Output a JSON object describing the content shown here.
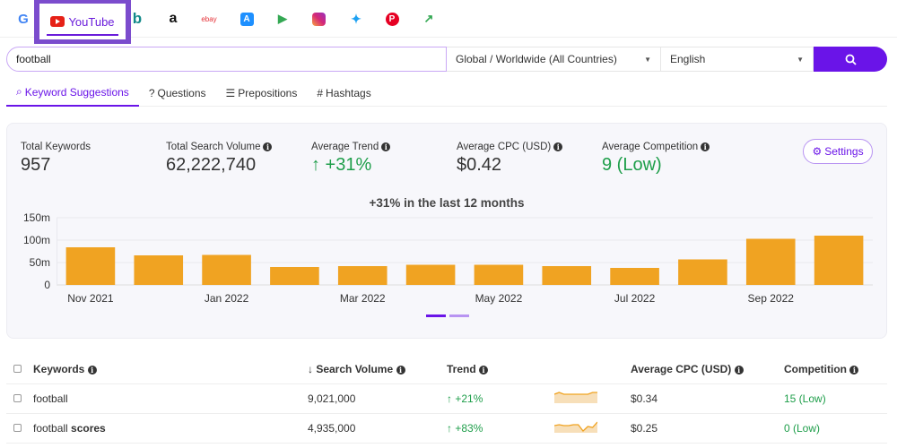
{
  "engines": [
    {
      "name": "google",
      "glyph": "G",
      "color": "#4285f4"
    },
    {
      "name": "youtube",
      "label": "YouTube",
      "active": true
    },
    {
      "name": "bing",
      "glyph": "b",
      "color": "#138a8a"
    },
    {
      "name": "amazon",
      "glyph": "a",
      "color": "#111"
    },
    {
      "name": "ebay",
      "glyph": "ebay",
      "color": "#e53238"
    },
    {
      "name": "app-store",
      "glyph": "A",
      "color": "#1e90ff"
    },
    {
      "name": "play-store",
      "glyph": "▶",
      "color": "#34a853"
    },
    {
      "name": "instagram",
      "glyph": "◎",
      "color": "#c13584"
    },
    {
      "name": "twitter",
      "glyph": "🐦",
      "color": "#1da1f2"
    },
    {
      "name": "pinterest",
      "glyph": "P",
      "color": "#e60023"
    },
    {
      "name": "trends",
      "glyph": "↗",
      "color": "#34a853"
    }
  ],
  "search": {
    "value": "football",
    "location": "Global / Worldwide (All Countries)",
    "language": "English"
  },
  "tabs": [
    {
      "icon": "⌕",
      "label": "Keyword Suggestions",
      "active": true
    },
    {
      "icon": "?",
      "label": "Questions"
    },
    {
      "icon": "☰",
      "label": "Prepositions"
    },
    {
      "icon": "#",
      "label": "Hashtags"
    }
  ],
  "stats": {
    "total_keywords": {
      "label": "Total Keywords",
      "value": "957"
    },
    "total_volume": {
      "label": "Total Search Volume",
      "value": "62,222,740"
    },
    "avg_trend": {
      "label": "Average Trend",
      "value": "↑ +31%"
    },
    "avg_cpc": {
      "label": "Average CPC (USD)",
      "value": "$0.42"
    },
    "avg_competition": {
      "label": "Average Competition",
      "value": "9 (Low)"
    }
  },
  "settings_label": "Settings",
  "chart_data": {
    "type": "bar",
    "title": "+31% in the last 12 months",
    "categories": [
      "Nov 2021",
      "Dec 2021",
      "Jan 2022",
      "Feb 2022",
      "Mar 2022",
      "Apr 2022",
      "May 2022",
      "Jun 2022",
      "Jul 2022",
      "Aug 2022",
      "Sep 2022",
      "Oct 2022"
    ],
    "values": [
      84,
      66,
      67,
      40,
      42,
      45,
      45,
      42,
      38,
      57,
      103,
      110
    ],
    "unit": "m",
    "xtick_labels": [
      "Nov 2021",
      "",
      "Jan 2022",
      "",
      "Mar 2022",
      "",
      "May 2022",
      "",
      "Jul 2022",
      "",
      "Sep 2022",
      ""
    ],
    "yticks": [
      "0",
      "50m",
      "100m",
      "150m"
    ],
    "ylim": [
      0,
      150
    ],
    "color": "#f0a322",
    "grid": true
  },
  "table": {
    "headers": [
      "Keywords",
      "↓ Search Volume",
      "Trend",
      "Average CPC (USD)",
      "Competition"
    ],
    "rows": [
      {
        "keyword": "football",
        "bold": "",
        "volume": "9,021,000",
        "trend": "↑ +21%",
        "cpc": "$0.34",
        "competition": "15 (Low)",
        "spark": [
          5,
          6,
          5,
          5,
          5,
          5,
          5,
          5,
          6,
          6
        ]
      },
      {
        "keyword": "football ",
        "bold": "scores",
        "volume": "4,935,000",
        "trend": "↑ +83%",
        "cpc": "$0.25",
        "competition": "0 (Low)",
        "spark": [
          4,
          4.5,
          4,
          4,
          4.5,
          4.5,
          1,
          3.5,
          3,
          6
        ]
      }
    ]
  }
}
